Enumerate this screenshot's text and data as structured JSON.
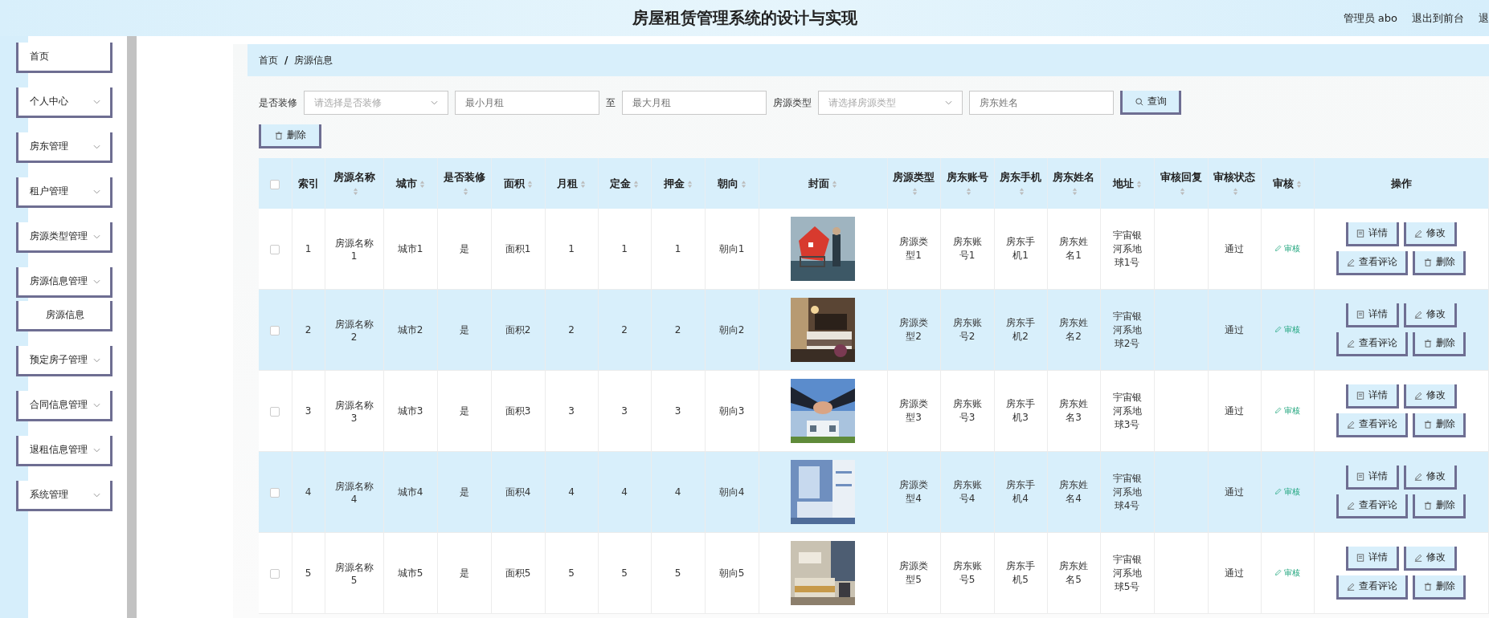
{
  "header": {
    "title": "房屋租赁管理系统的设计与实现",
    "user": "管理员 abo",
    "links": [
      "退出到前台",
      "退"
    ]
  },
  "sidebar": {
    "items": [
      {
        "label": "首页",
        "expandable": false
      },
      {
        "label": "个人中心",
        "expandable": true
      },
      {
        "label": "房东管理",
        "expandable": true
      },
      {
        "label": "租户管理",
        "expandable": true
      },
      {
        "label": "房源类型管理",
        "expandable": true
      },
      {
        "label": "房源信息管理",
        "expandable": true,
        "children": [
          {
            "label": "房源信息"
          }
        ]
      },
      {
        "label": "预定房子管理",
        "expandable": true
      },
      {
        "label": "合同信息管理",
        "expandable": true
      },
      {
        "label": "退租信息管理",
        "expandable": true
      },
      {
        "label": "系统管理",
        "expandable": true
      }
    ]
  },
  "breadcrumb": {
    "items": [
      "首页",
      "房源信息"
    ],
    "separator": "/"
  },
  "filters": [
    {
      "kind": "label",
      "text": "是否装修"
    },
    {
      "kind": "select",
      "placeholder": "请选择是否装修"
    },
    {
      "kind": "input",
      "placeholder": "最小月租"
    },
    {
      "kind": "label",
      "text": "至"
    },
    {
      "kind": "input",
      "placeholder": "最大月租"
    },
    {
      "kind": "label",
      "text": "房源类型"
    },
    {
      "kind": "select",
      "placeholder": "请选择房源类型"
    },
    {
      "kind": "input",
      "placeholder": "房东姓名"
    },
    {
      "kind": "button",
      "text": "查询"
    }
  ],
  "toolbar": {
    "delete_button": "删除"
  },
  "table": {
    "header_checked": false,
    "columns": [
      {
        "label": "索引",
        "sortable": false
      },
      {
        "label": "房源名称",
        "sortable": true
      },
      {
        "label": "城市",
        "sortable": true
      },
      {
        "label": "是否装修",
        "sortable": true
      },
      {
        "label": "面积",
        "sortable": true
      },
      {
        "label": "月租",
        "sortable": true
      },
      {
        "label": "定金",
        "sortable": true
      },
      {
        "label": "押金",
        "sortable": true
      },
      {
        "label": "朝向",
        "sortable": true
      },
      {
        "label": "封面",
        "sortable": true
      },
      {
        "label": "房源类型",
        "sortable": true
      },
      {
        "label": "房东账号",
        "sortable": true
      },
      {
        "label": "房东手机",
        "sortable": true
      },
      {
        "label": "房东姓名",
        "sortable": true
      },
      {
        "label": "地址",
        "sortable": true
      },
      {
        "label": "审核回复",
        "sortable": true
      },
      {
        "label": "审核状态",
        "sortable": true
      },
      {
        "label": "审核",
        "sortable": true
      },
      {
        "label": "操作",
        "sortable": false
      }
    ],
    "rows": [
      {
        "checked": false,
        "cells": [
          "1",
          "房源名称1",
          "城市1",
          "是",
          "面积1",
          "1",
          "1",
          "1",
          "朝向1"
        ],
        "cells_after": [
          "房源类型1",
          "房东账号1",
          "房东手机1",
          "房东姓名1",
          "宇宙银河系地球1号"
        ],
        "status": "通过",
        "audit": "审核",
        "actions": [
          {
            "kind": "detail",
            "label": "详情"
          },
          {
            "kind": "edit",
            "label": "修改"
          },
          {
            "kind": "comment",
            "label": "查看评论"
          },
          {
            "kind": "delete",
            "label": "删除"
          }
        ]
      },
      {
        "checked": false,
        "cells": [
          "2",
          "房源名称2",
          "城市2",
          "是",
          "面积2",
          "2",
          "2",
          "2",
          "朝向2"
        ],
        "cells_after": [
          "房源类型2",
          "房东账号2",
          "房东手机2",
          "房东姓名2",
          "宇宙银河系地球2号"
        ],
        "status": "通过",
        "audit": "审核",
        "actions": [
          {
            "kind": "detail",
            "label": "详情"
          },
          {
            "kind": "edit",
            "label": "修改"
          },
          {
            "kind": "comment",
            "label": "查看评论"
          },
          {
            "kind": "delete",
            "label": "删除"
          }
        ]
      },
      {
        "checked": false,
        "cells": [
          "3",
          "房源名称3",
          "城市3",
          "是",
          "面积3",
          "3",
          "3",
          "3",
          "朝向3"
        ],
        "cells_after": [
          "房源类型3",
          "房东账号3",
          "房东手机3",
          "房东姓名3",
          "宇宙银河系地球3号"
        ],
        "status": "通过",
        "audit": "审核",
        "actions": [
          {
            "kind": "detail",
            "label": "详情"
          },
          {
            "kind": "edit",
            "label": "修改"
          },
          {
            "kind": "comment",
            "label": "查看评论"
          },
          {
            "kind": "delete",
            "label": "删除"
          }
        ]
      },
      {
        "checked": false,
        "cells": [
          "4",
          "房源名称4",
          "城市4",
          "是",
          "面积4",
          "4",
          "4",
          "4",
          "朝向4"
        ],
        "cells_after": [
          "房源类型4",
          "房东账号4",
          "房东手机4",
          "房东姓名4",
          "宇宙银河系地球4号"
        ],
        "status": "通过",
        "audit": "审核",
        "actions": [
          {
            "kind": "detail",
            "label": "详情"
          },
          {
            "kind": "edit",
            "label": "修改"
          },
          {
            "kind": "comment",
            "label": "查看评论"
          },
          {
            "kind": "delete",
            "label": "删除"
          }
        ]
      },
      {
        "checked": false,
        "cells": [
          "5",
          "房源名称5",
          "城市5",
          "是",
          "面积5",
          "5",
          "5",
          "5",
          "朝向5"
        ],
        "cells_after": [
          "房源类型5",
          "房东账号5",
          "房东手机5",
          "房东姓名5",
          "宇宙银河系地球5号"
        ],
        "status": "通过",
        "audit": "审核",
        "actions": [
          {
            "kind": "detail",
            "label": "详情"
          },
          {
            "kind": "edit",
            "label": "修改"
          },
          {
            "kind": "comment",
            "label": "查看评论"
          },
          {
            "kind": "delete",
            "label": "删除"
          }
        ]
      }
    ]
  }
}
